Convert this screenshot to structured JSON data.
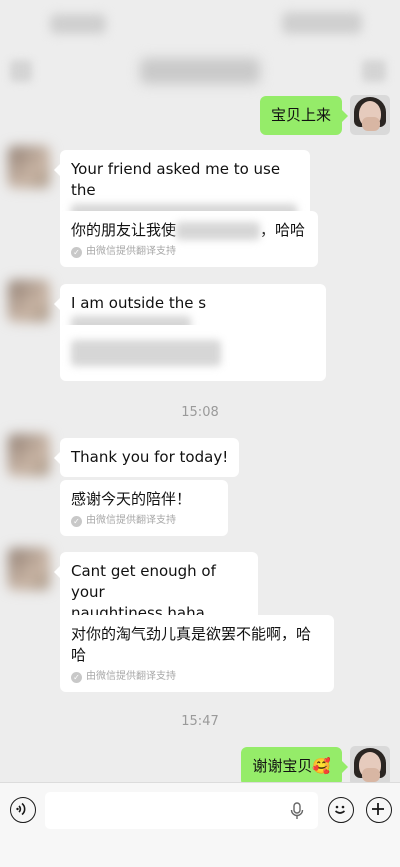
{
  "messages": [
    {
      "text": "宝贝上来"
    },
    {
      "text_prefix": "Your friend asked me to use the"
    },
    {
      "text_prefix": "你的朋友让我使",
      "text_suffix": "，哈哈",
      "note": "由微信提供翻译支持"
    },
    {
      "text_prefix": "I am outside the s"
    },
    {
      "time": "15:08"
    },
    {
      "text": "Thank you for today!"
    },
    {
      "text": "感谢今天的陪伴！",
      "note": "由微信提供翻译支持"
    },
    {
      "line1": "Cant get enough of your",
      "line2": "naughtiness haha"
    },
    {
      "line1": "对你的淘气劲儿真是欲罢不能啊，哈",
      "line2": "哈",
      "note": "由微信提供翻译支持"
    },
    {
      "time": "15:47"
    },
    {
      "text": "谢谢宝贝🥰"
    }
  ],
  "input": {
    "placeholder": ""
  }
}
